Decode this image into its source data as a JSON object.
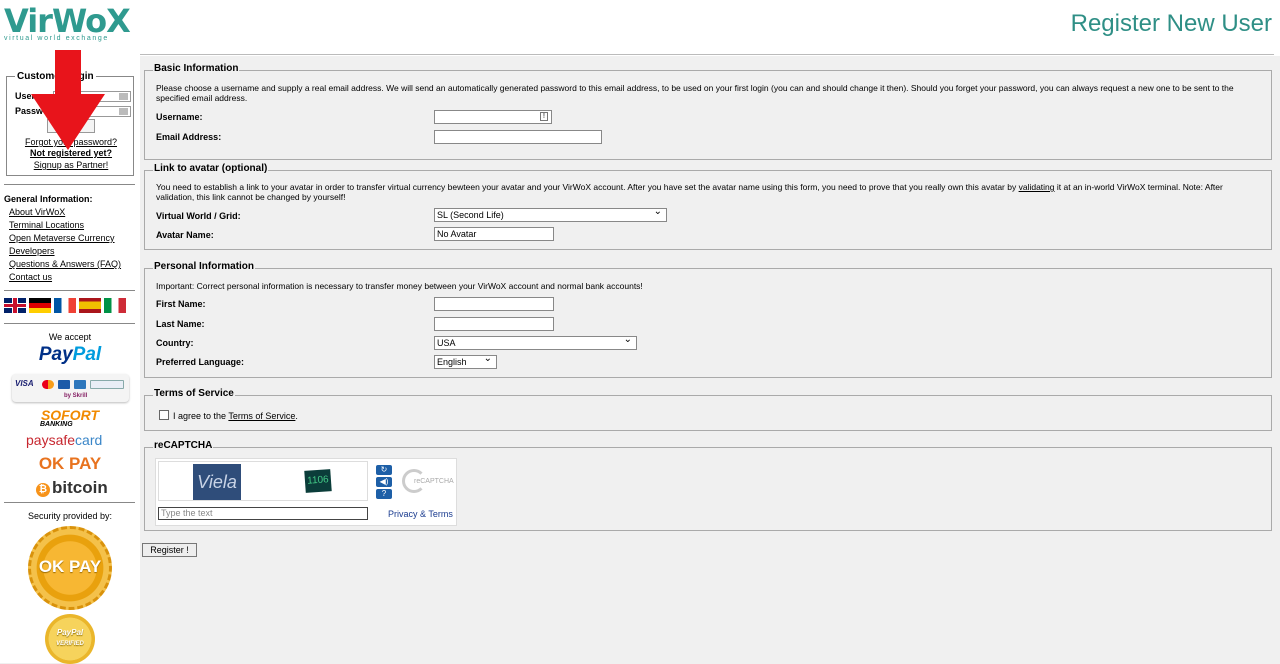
{
  "header": {
    "logo_text": "VirWoX",
    "logo_sub": "virtual world exchange",
    "title": "Register New User"
  },
  "login": {
    "legend": "Customer Login",
    "username_label": "Username:",
    "password_label": "Password:",
    "forgot": "Forgot your password?",
    "not_registered": "Not registered yet?",
    "partner": "Signup as Partner!"
  },
  "general": {
    "title": "General Information:",
    "links": [
      "About VirWoX",
      "Terminal Locations",
      "Open Metaverse Currency",
      "Developers",
      "Questions & Answers (FAQ)",
      "Contact us"
    ]
  },
  "payments": {
    "accept_label": "We accept",
    "paypal": [
      "Pay",
      "Pal"
    ],
    "visa": "VISA",
    "skrill": "by Skrill",
    "sofort": "SOFORT",
    "sofort_sub": "BANKING",
    "paysafe": [
      "paysafe",
      "card"
    ],
    "okpay": "OK PAY",
    "bitcoin": "bitcoin",
    "bitcoin_symbol": "₿"
  },
  "security": {
    "label": "Security provided by:",
    "okpay_seal": "OK PAY",
    "paypal_seal": [
      "PayPal",
      "VERIFIED"
    ]
  },
  "basic": {
    "legend": "Basic Information",
    "description": "Please choose a username and supply a real email address. We will send an automatically generated password to this email address, to be used on your first login (you can and should change it then). Should you forget your password, you can always request a new one to be sent to the specified email address.",
    "username_label": "Username:",
    "username_value": "",
    "email_label": "Email Address:",
    "email_value": ""
  },
  "avatar": {
    "legend": "Link to avatar (optional)",
    "description_pre": "You need to establish a link to your avatar in order to transfer virtual currency bewteen your avatar and your VirWoX account. After you have set the avatar name using this form, you need to prove that you really own this avatar by ",
    "description_link": "validating",
    "description_post": " it at an in-world VirWoX terminal. Note: After validation, this link cannot be changed by yourself!",
    "world_label": "Virtual World / Grid:",
    "world_value": "SL (Second Life)",
    "name_label": "Avatar Name:",
    "name_value": "No Avatar"
  },
  "personal": {
    "legend": "Personal Information",
    "description": "Important: Correct personal information is necessary to transfer money between your VirWoX account and normal bank accounts!",
    "first_label": "First Name:",
    "first_value": "",
    "last_label": "Last Name:",
    "last_value": "",
    "country_label": "Country:",
    "country_value": "USA",
    "language_label": "Preferred Language:",
    "language_value": "English"
  },
  "terms": {
    "legend": "Terms of Service",
    "agree_pre": "I agree to the ",
    "agree_link": "Terms of Service",
    "agree_post": "."
  },
  "recaptcha": {
    "legend": "reCAPTCHA",
    "word1": "Viela",
    "word2": "1106",
    "placeholder": "Type the text",
    "refresh_icon": "↻",
    "audio_icon": "◀)",
    "help_icon": "?",
    "logo_text": "reCAPTCHA",
    "terms": "Privacy & Terms"
  },
  "register_button": "Register !"
}
